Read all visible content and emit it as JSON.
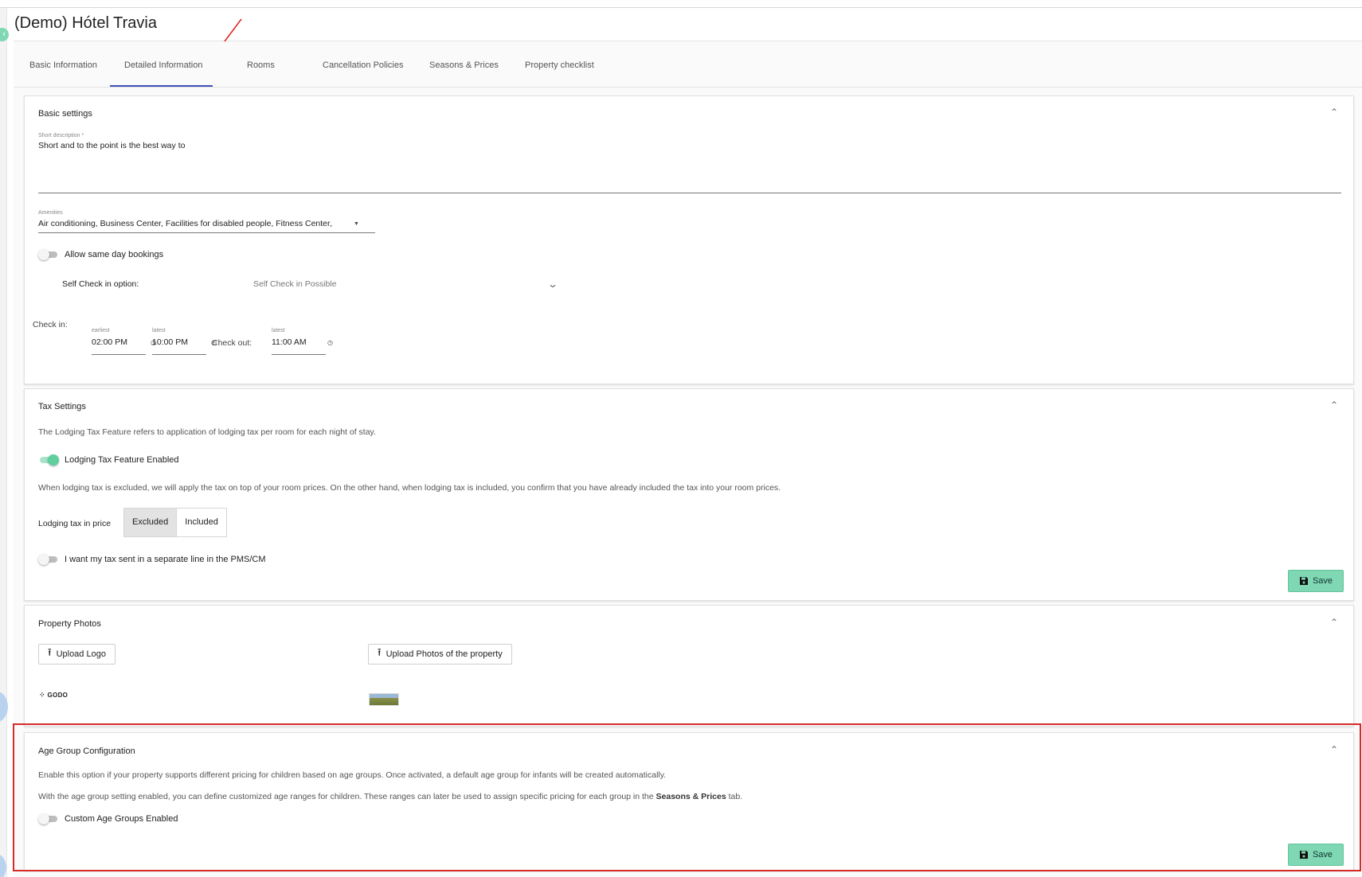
{
  "page": {
    "title": "(Demo) Hótel Travia"
  },
  "tabs": [
    {
      "label": "Basic Information"
    },
    {
      "label": "Detailed Information"
    },
    {
      "label": "Rooms"
    },
    {
      "label": "Cancellation Policies"
    },
    {
      "label": "Seasons & Prices"
    },
    {
      "label": "Property checklist"
    }
  ],
  "basic_settings": {
    "title": "Basic settings",
    "short_description_label": "Short description *",
    "short_description_value": "Short and to the point is the best way to",
    "amenities_label": "Amenities",
    "amenities_value": "Air conditioning, Business Center, Facilities for disabled people, Fitness Center,...",
    "same_day_label": "Allow same day bookings",
    "self_checkin_label": "Self Check in option:",
    "self_checkin_value": "Self Check in Possible",
    "checkin_label": "Check in:",
    "checkout_label": "Check out:",
    "earliest_label": "earliest",
    "latest_label": "latest",
    "checkin_earliest": "02:00 PM",
    "checkin_latest": "10:00 PM",
    "checkout_latest": "11:00 AM"
  },
  "tax_settings": {
    "title": "Tax Settings",
    "description": "The Lodging Tax Feature refers to application of lodging tax per room for each night of stay.",
    "feature_toggle_label": "Lodging Tax Feature Enabled",
    "explanation": "When lodging tax is excluded, we will apply the tax on top of your room prices. On the other hand, when lodging tax is included, you confirm that you have already included the tax into your room prices.",
    "tax_in_price_label": "Lodging tax in price",
    "option_excluded": "Excluded",
    "option_included": "Included",
    "separate_line_label": "I want my tax sent in a separate line in the PMS/CM",
    "save_label": "Save"
  },
  "property_photos": {
    "title": "Property Photos",
    "upload_logo_label": "Upload Logo",
    "upload_photos_label": "Upload Photos of the property",
    "logo_text": "GODO"
  },
  "age_group": {
    "title": "Age Group Configuration",
    "description": "Enable this option if your property supports different pricing for children based on age groups. Once activated, a default age group for infants will be created automatically.",
    "explanation_before": "With the age group setting enabled, you can define customized age ranges for children. These ranges can later be used to assign specific pricing for each group in the ",
    "explanation_link": "Seasons & Prices",
    "explanation_after": " tab.",
    "toggle_label": "Custom Age Groups Enabled",
    "save_label": "Save"
  },
  "colors": {
    "accent_green": "#7fd8b3",
    "tab_indicator": "#3f51b5",
    "highlight_red": "#d42a2a"
  }
}
